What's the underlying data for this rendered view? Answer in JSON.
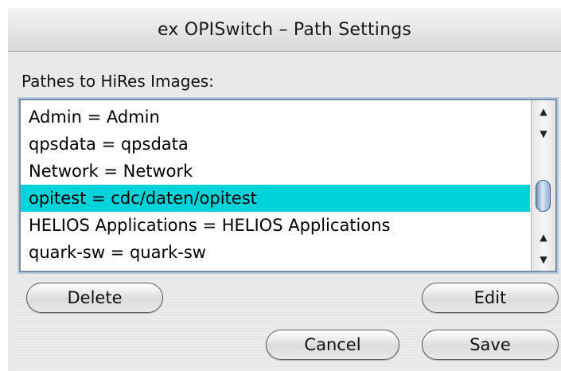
{
  "window": {
    "title": "ex OPISwitch – Path Settings"
  },
  "pathes": {
    "label": "Pathes to HiRes Images:",
    "items": [
      "Admin = Admin",
      "qpsdata = qpsdata",
      "Network = Network",
      "opitest = cdc/daten/opitest",
      "HELIOS Applications = HELIOS Applications",
      "quark-sw = quark-sw"
    ],
    "selected_index": 3
  },
  "scrollbar": {
    "up_arrow": "▲",
    "down_arrow": "▼"
  },
  "buttons": {
    "delete": "Delete",
    "edit": "Edit",
    "cancel": "Cancel",
    "save": "Save"
  },
  "colors": {
    "selection": "#00d4da",
    "list_border": "#7c8fa8",
    "scroll_thumb": "#8fb0d6"
  }
}
